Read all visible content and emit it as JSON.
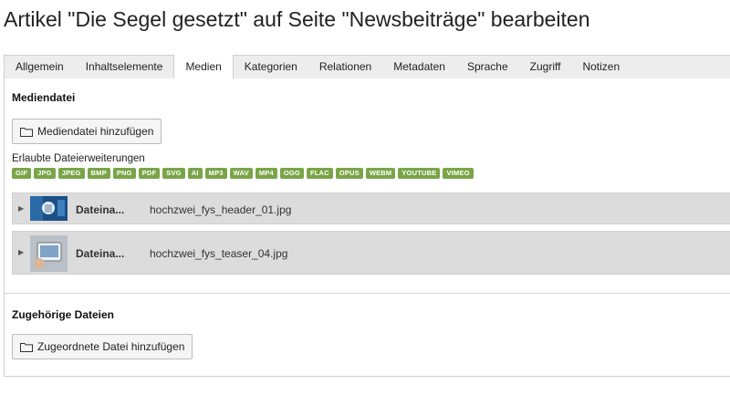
{
  "page": {
    "title": "Artikel \"Die Segel gesetzt\" auf Seite \"Newsbeiträge\" bearbeiten"
  },
  "tabs": [
    {
      "label": "Allgemein"
    },
    {
      "label": "Inhaltselemente"
    },
    {
      "label": "Medien",
      "active": true
    },
    {
      "label": "Kategorien"
    },
    {
      "label": "Relationen"
    },
    {
      "label": "Metadaten"
    },
    {
      "label": "Sprache"
    },
    {
      "label": "Zugriff"
    },
    {
      "label": "Notizen"
    }
  ],
  "media": {
    "section_title": "Mediendatei",
    "add_button": "Mediendatei hinzufügen",
    "extensions_label": "Erlaubte Dateierweiterungen",
    "extensions": [
      "GIF",
      "JPG",
      "JPEG",
      "BMP",
      "PNG",
      "PDF",
      "SVG",
      "AI",
      "MP3",
      "WAV",
      "MP4",
      "OGG",
      "FLAC",
      "OPUS",
      "WEBM",
      "YOUTUBE",
      "VIMEO"
    ],
    "badge_color": "#79a548",
    "files": [
      {
        "label": "Dateina...",
        "filename": "hochzwei_fys_header_01.jpg"
      },
      {
        "label": "Dateina...",
        "filename": "hochzwei_fys_teaser_04.jpg"
      }
    ]
  },
  "related": {
    "section_title": "Zugehörige Dateien",
    "add_button": "Zugeordnete Datei hinzufügen"
  }
}
